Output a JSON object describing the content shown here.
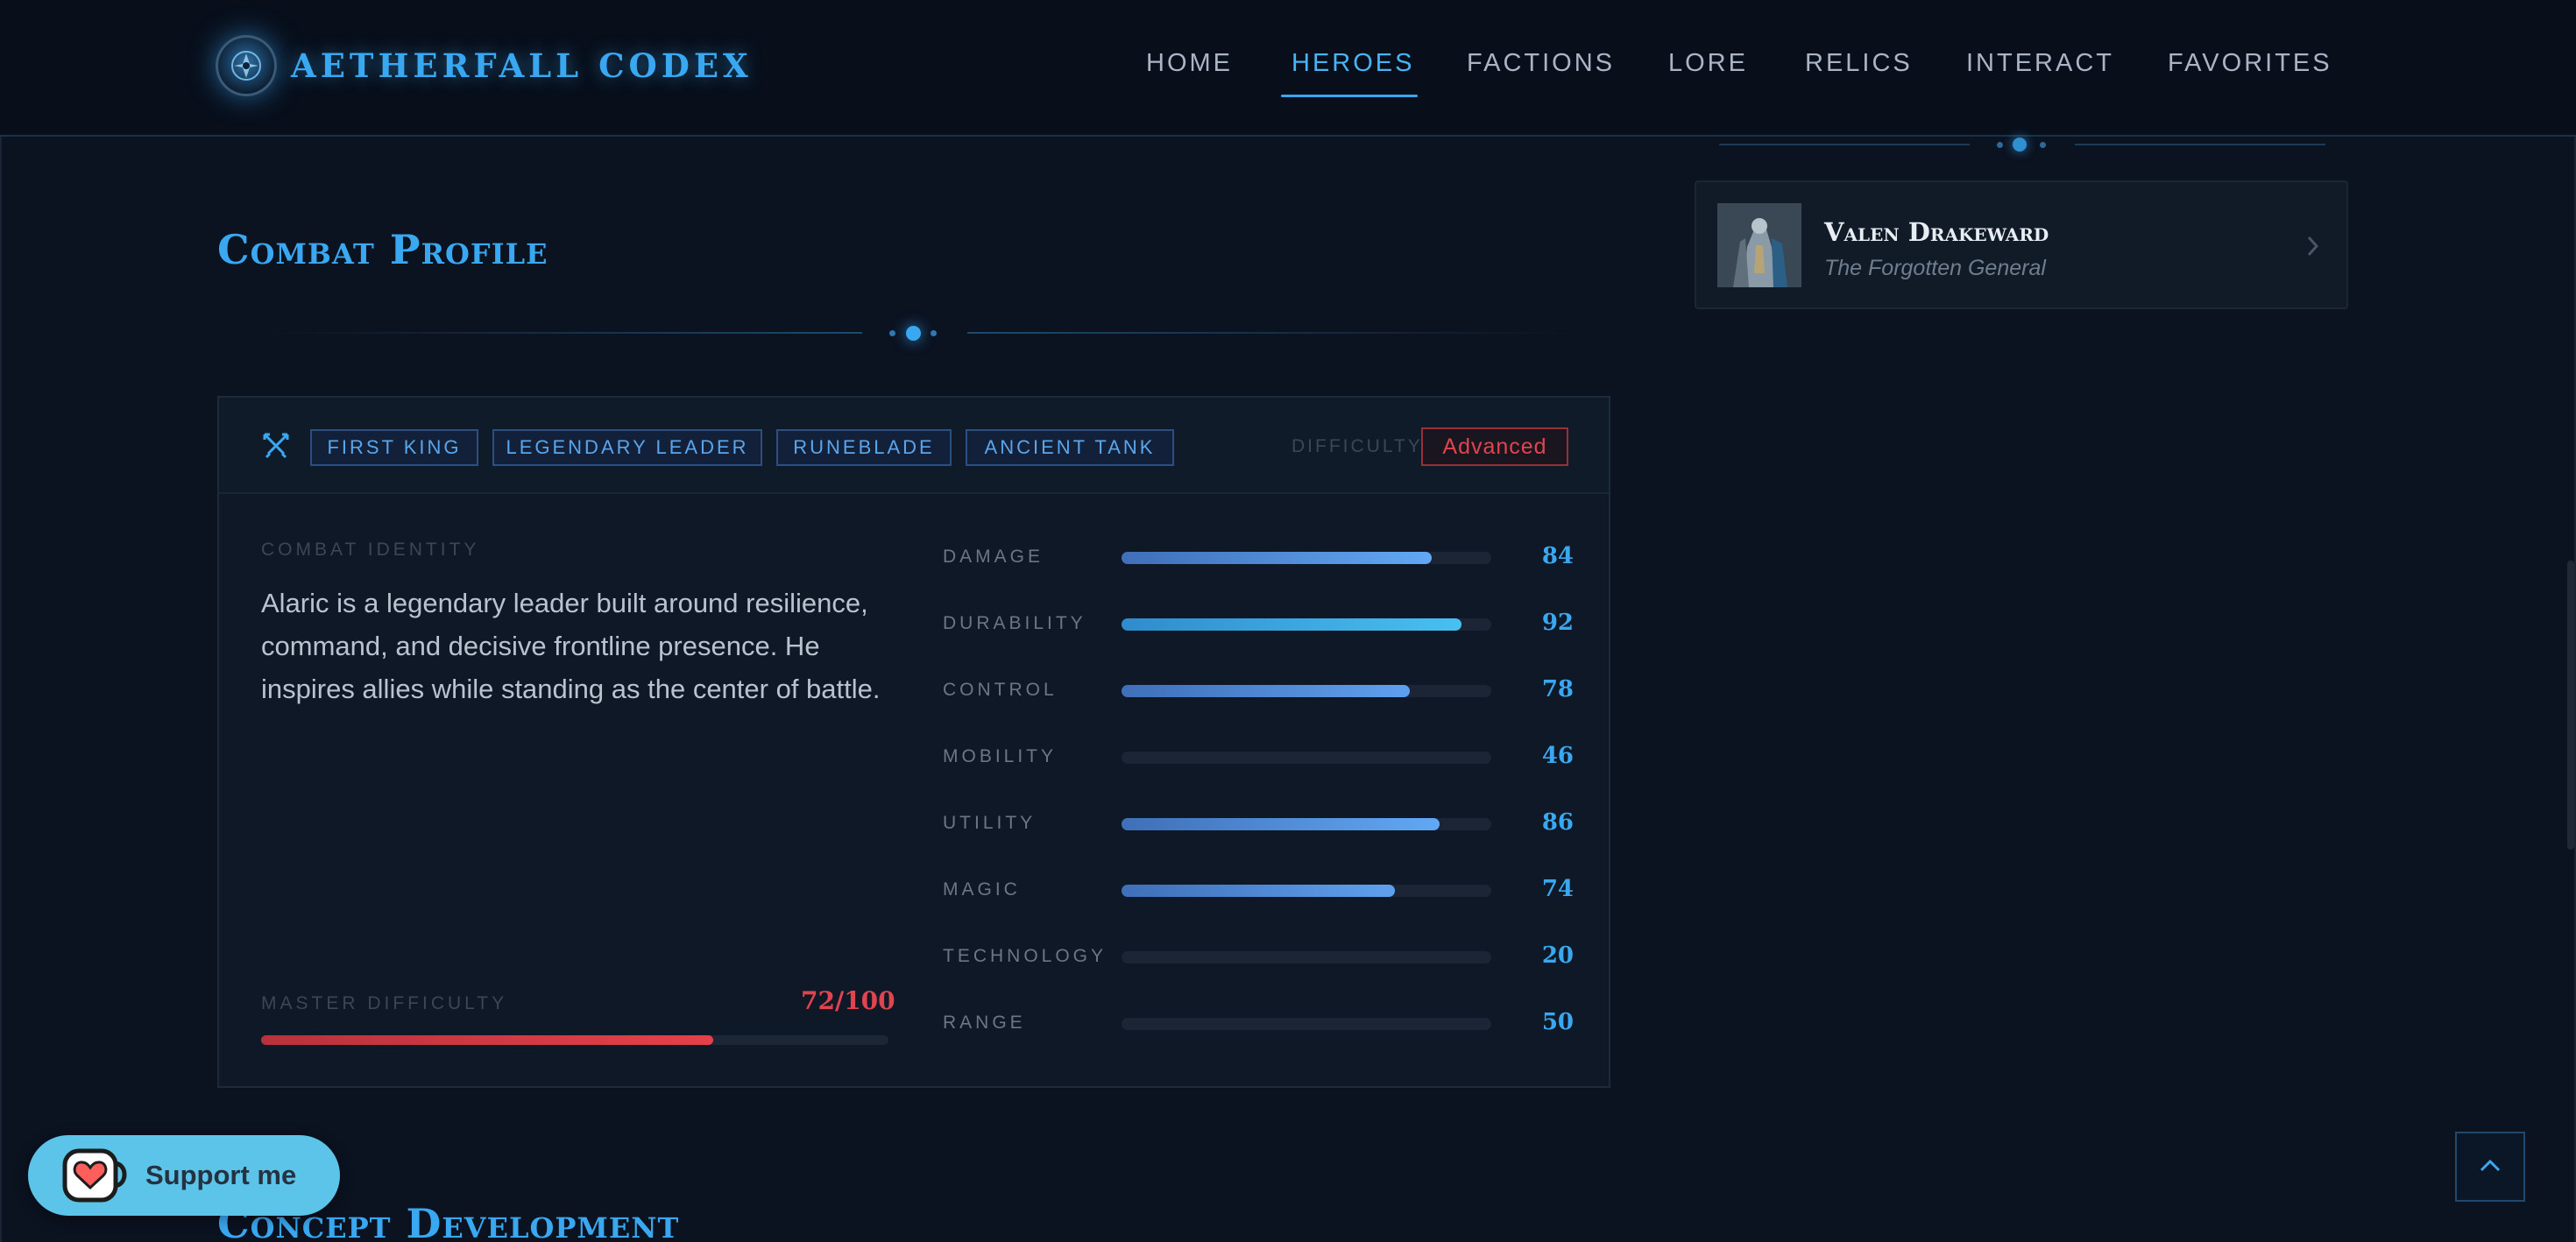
{
  "header": {
    "logo_text": "AETHERFALL CODEX",
    "nav": [
      {
        "label": "HOME",
        "active": false
      },
      {
        "label": "HEROES",
        "active": true
      },
      {
        "label": "FACTIONS",
        "active": false
      },
      {
        "label": "LORE",
        "active": false
      },
      {
        "label": "RELICS",
        "active": false
      },
      {
        "label": "INTERACT",
        "active": false
      },
      {
        "label": "FAVORITES",
        "active": false
      }
    ]
  },
  "sidebar": {
    "related_hero": {
      "name": "Valen Drakeward",
      "subtitle": "The Forgotten General"
    }
  },
  "combat_profile": {
    "title": "Combat Profile",
    "tags": [
      "FIRST KING",
      "LEGENDARY LEADER",
      "RUNEBLADE",
      "ANCIENT TANK"
    ],
    "difficulty_label": "DIFFICULTY",
    "difficulty_value": "Advanced",
    "combat_identity_label": "COMBAT IDENTITY",
    "combat_identity_text": "Alaric is a legendary leader built around resilience, command, and decisive frontline presence. He inspires allies while standing as the center of battle.",
    "master_difficulty_label": "MASTER DIFFICULTY",
    "master_difficulty_value": "72/100",
    "master_difficulty_fraction": 0.72,
    "stats": [
      {
        "label": "DAMAGE",
        "value": "84",
        "level": 84
      },
      {
        "label": "DURABILITY",
        "value": "92",
        "level": 92
      },
      {
        "label": "CONTROL",
        "value": "78",
        "level": 78
      },
      {
        "label": "MOBILITY",
        "value": "46",
        "level": 0
      },
      {
        "label": "UTILITY",
        "value": "86",
        "level": 86
      },
      {
        "label": "MAGIC",
        "value": "74",
        "level": 74
      },
      {
        "label": "TECHNOLOGY",
        "value": "20",
        "level": 0
      },
      {
        "label": "RANGE",
        "value": "50",
        "level": 0
      }
    ]
  },
  "next_section_title": "Concept Development",
  "support_button": {
    "label": "Support me"
  },
  "colors": {
    "accent": "#3aa8f0",
    "danger": "#e0444e",
    "background": "#0b1220"
  },
  "icons": {
    "logo": "crest-emblem-icon",
    "tags": "crossed-swords-icon",
    "hero_link": "chevron-right-icon",
    "support": "coffee-cup-heart-icon",
    "scroll_top": "chevron-up-icon"
  }
}
